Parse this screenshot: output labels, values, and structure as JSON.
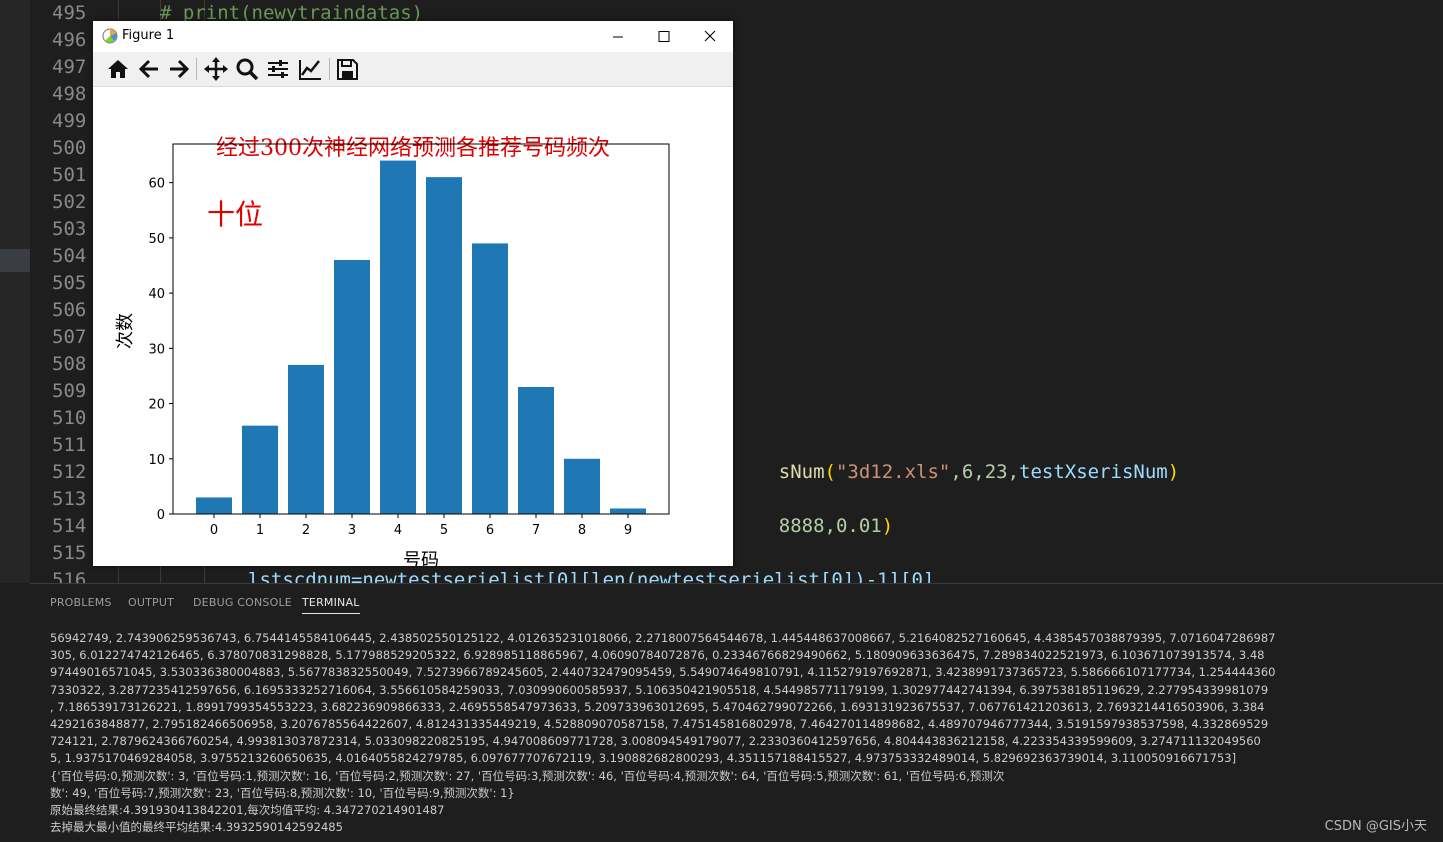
{
  "editor": {
    "line_numbers": [
      "495",
      "496",
      "497",
      "498",
      "499",
      "500",
      "501",
      "502",
      "503",
      "504",
      "505",
      "506",
      "507",
      "508",
      "509",
      "510",
      "511",
      "512",
      "513",
      "514",
      "515",
      "516"
    ],
    "visible_code": {
      "line495": "# print(newytraindatas)",
      "line511_tail": {
        "fn": "sNum",
        "open": "(",
        "str": "\"3d12.xls\"",
        "args": ",6,23,",
        "var": "testXserisNum",
        "close": ")"
      },
      "line513_tail": {
        "num": "8888,0.01",
        "close": ")"
      },
      "line516": "lstscdnum=newtestserielist[0][len(newtestserielist[0])-1][0]"
    }
  },
  "figure_window": {
    "title": "Figure 1",
    "toolbar": [
      "home-icon",
      "back-icon",
      "forward-icon",
      "pan-icon",
      "zoom-icon",
      "configure-subplots-icon",
      "edit-axis-icon",
      "save-icon"
    ]
  },
  "chart_data": {
    "type": "bar",
    "title": "经过300次神经网络预测各推荐号码频次",
    "annotation": "十位",
    "xlabel": "号码",
    "ylabel": "次数",
    "categories": [
      "0",
      "1",
      "2",
      "3",
      "4",
      "5",
      "6",
      "7",
      "8",
      "9"
    ],
    "values": [
      3,
      16,
      27,
      46,
      64,
      61,
      49,
      23,
      10,
      1
    ],
    "ylim": [
      0,
      67
    ],
    "yticks": [
      "0",
      "10",
      "20",
      "30",
      "40",
      "50",
      "60"
    ],
    "bar_color": "#1f77b4",
    "title_color": "#e00000",
    "grid": false
  },
  "panel": {
    "tabs": [
      "PROBLEMS",
      "OUTPUT",
      "DEBUG CONSOLE",
      "TERMINAL"
    ],
    "active_tab": "TERMINAL",
    "terminal_lines": [
      "56942749, 2.743906259536743, 6.7544145584106445, 2.438502550125122, 4.012635231018066, 2.2718007564544678, 1.445448637008667, 5.2164082527160645, 4.4385457038879395, 7.0716047286987",
      "305, 6.012274742126465, 6.378070831298828, 5.177988529205322, 6.928985118865967, 4.06090784072876, 0.23346766829490662, 5.180909633636475, 7.289834022521973, 6.103671073913574, 3.48",
      "97449016571045, 3.530336380004883, 5.567783832550049, 7.5273966789245605, 2.440732479095459, 5.549074649810791, 4.115279197692871, 3.4238991737365723, 5.586666107177734, 1.254444360",
      "7330322, 3.2877235412597656, 6.1695333252716064, 3.556610584259033, 7.030990600585937, 5.106350421905518, 4.544985771179199, 1.302977442741394, 6.397538185119629, 2.277954339981079",
      ", 7.186539173126221, 1.8991799354553223, 3.682236909866333, 2.4695558547973633, 5.209733963012695, 5.470462799072266, 1.693131923675537, 7.067761421203613, 2.7693214416503906, 3.384",
      "4292163848877, 2.795182466506958, 3.2076785564422607, 4.812431335449219, 4.528809070587158, 7.475145816802978, 7.464270114898682, 4.489707946777344, 3.5191597938537598, 4.332869529",
      "724121, 2.7879624366760254, 4.993813037872314, 5.033098220825195, 4.947008609771728, 3.008094549179077, 2.2330360412597656, 4.804443836212158, 4.223354339599609, 3.274711132049560",
      "5, 1.9375170469284058, 3.9755213260650635, 4.0164055824279785, 6.097677707672119, 3.190882682800293, 4.351157188415527, 4.973753332489014, 5.829692363739014, 3.110050916671753]",
      "{'百位号码:0,预测次数': 3, '百位号码:1,预测次数': 16, '百位号码:2,预测次数': 27, '百位号码:3,预测次数': 46, '百位号码:4,预测次数': 64, '百位号码:5,预测次数': 61, '百位号码:6,预测次",
      "数': 49, '百位号码:7,预测次数': 23, '百位号码:8,预测次数': 10, '百位号码:9,预测次数': 1}",
      "原始最终结果:4.391930413842201,每次均值平均: 4.347270214901487",
      "去掉最大最小值的最终平均结果:4.3932590142592485"
    ]
  },
  "watermark": "CSDN @GIS小天"
}
